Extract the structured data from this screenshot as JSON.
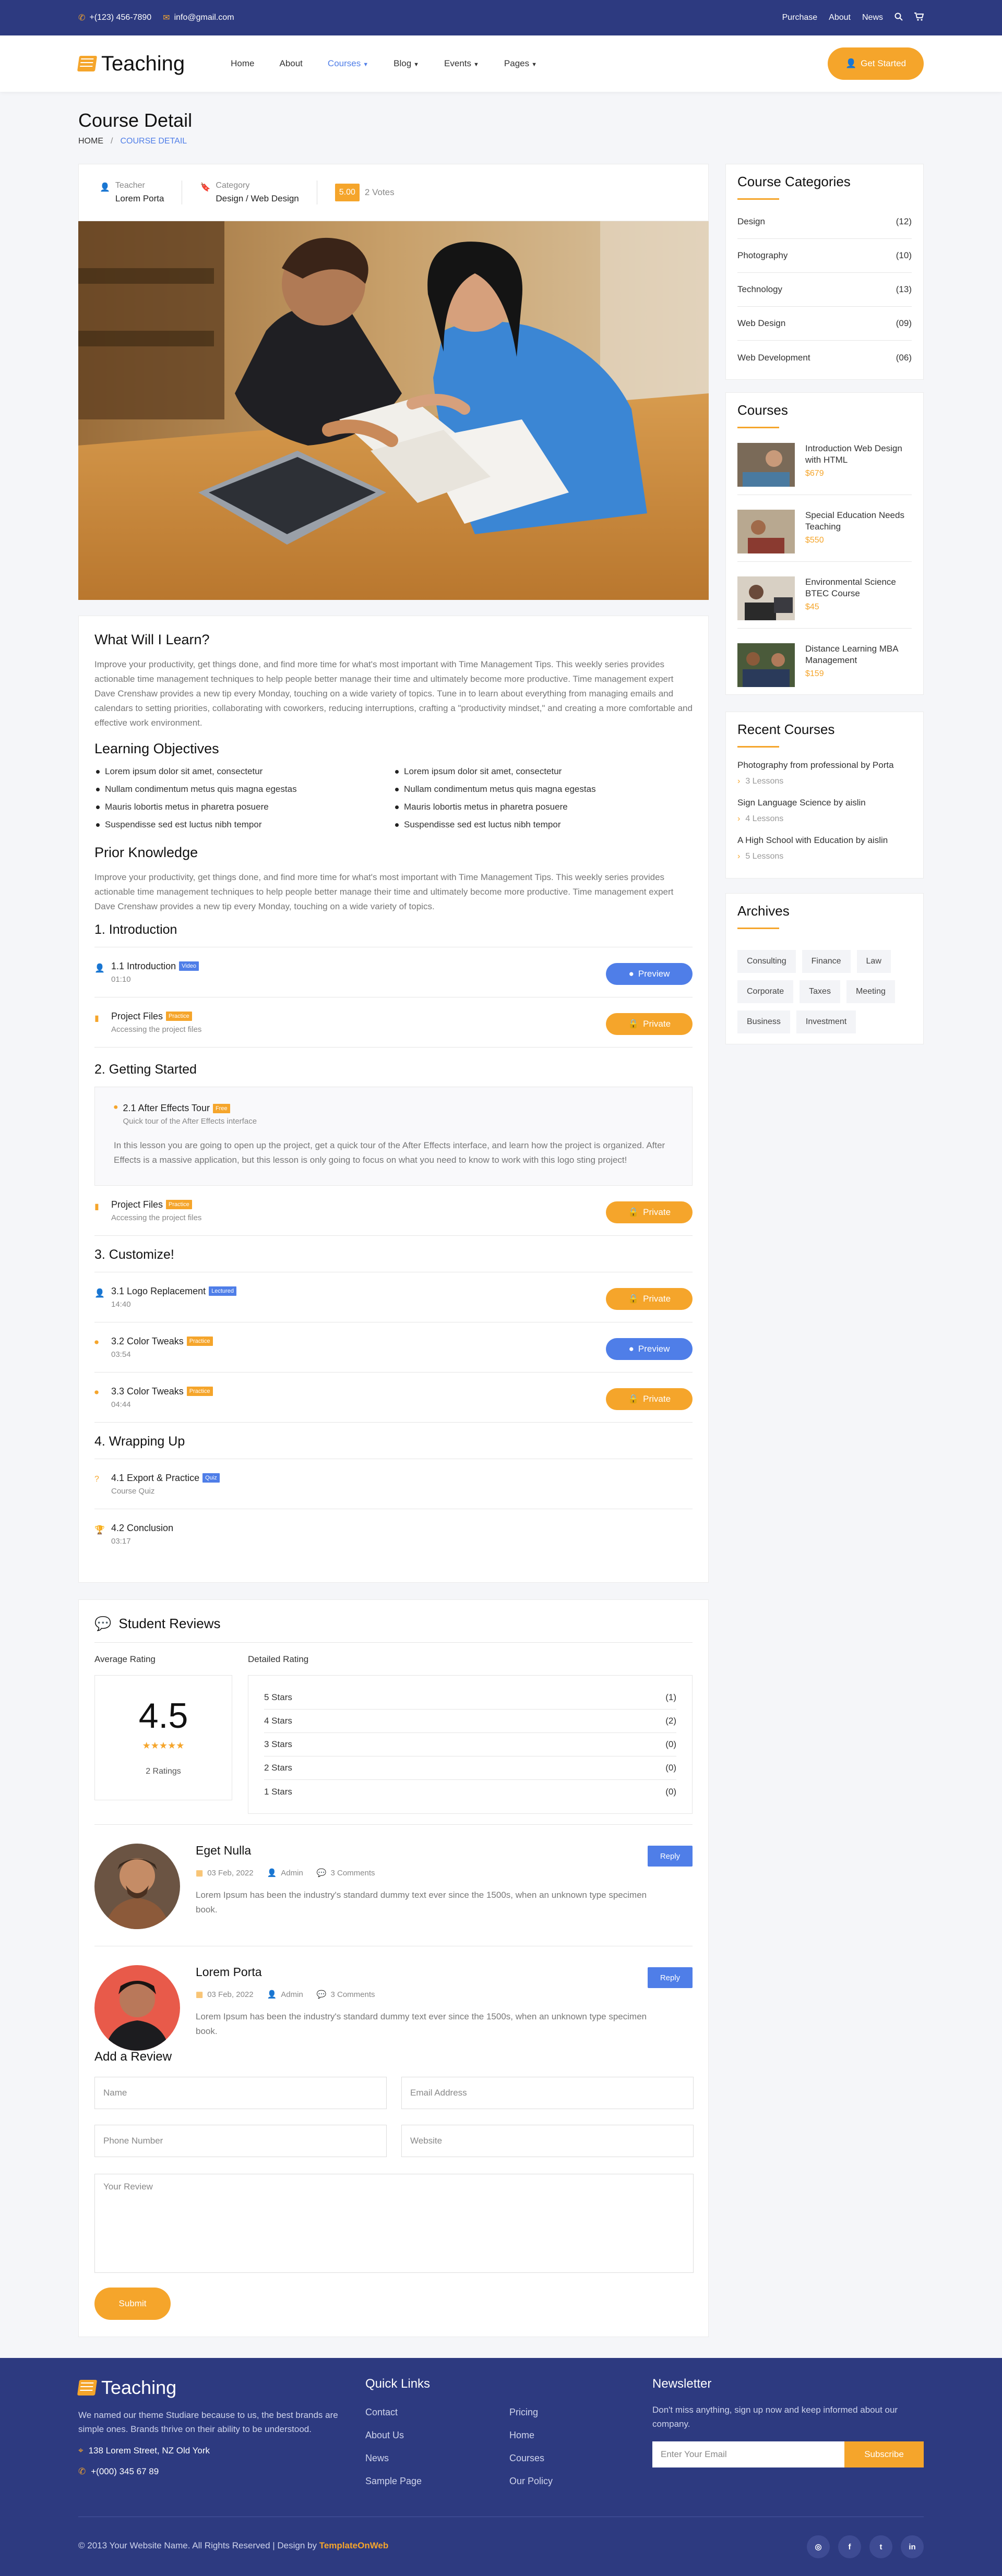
{
  "topbar": {
    "phone": "+(123) 456-7890",
    "email": "info@gmail.com",
    "links": [
      "Purchase",
      "About",
      "News"
    ]
  },
  "nav": {
    "logo": "Teaching",
    "items": [
      "Home",
      "About",
      "Courses",
      "Blog",
      "Events",
      "Pages"
    ],
    "cta": "Get Started"
  },
  "page": {
    "title": "Course Detail",
    "crumb_home": "HOME",
    "crumb_sep": "/",
    "crumb_current": "COURSE DETAIL"
  },
  "meta": {
    "teacher_label": "Teacher",
    "teacher": "Lorem Porta",
    "category_label": "Category",
    "category": "Design / Web Design",
    "rating": "5.00",
    "votes": "2 Votes"
  },
  "learn": {
    "title": "What Will I Learn?",
    "text": "Improve your productivity, get things done, and find more time for what's most important with Time Management Tips. This weekly series provides actionable time management techniques to help people better manage their time and ultimately become more productive. Time management expert Dave Crenshaw provides a new tip every Monday, touching on a wide variety of topics. Tune in to learn about everything from managing emails and calendars to setting priorities, collaborating with coworkers, reducing interruptions, crafting a \"productivity mindset,\" and creating a more comfortable and effective work environment.",
    "objectives_title": "Learning Objectives",
    "objectives": [
      "Lorem ipsum dolor sit amet, consectetur",
      "Lorem ipsum dolor sit amet, consectetur",
      "Nullam condimentum metus quis magna egestas",
      "Nullam condimentum metus quis magna egestas",
      "Mauris lobortis metus in pharetra posuere",
      "Mauris lobortis metus in pharetra posuere",
      "Suspendisse sed est luctus nibh tempor",
      "Suspendisse sed est luctus nibh tempor"
    ],
    "prior_title": "Prior Knowledge",
    "prior_text": "Improve your productivity, get things done, and find more time for what's most important with Time Management Tips. This weekly series provides actionable time management techniques to help people better manage their time and ultimately become more productive. Time management expert Dave Crenshaw provides a new tip every Monday, touching on a wide variety of topics."
  },
  "curriculum": {
    "s1": "1. Introduction",
    "l11": {
      "title": "1.1 Introduction",
      "tag": "Video",
      "sub": "01:10",
      "btn": "Preview"
    },
    "l12": {
      "title": "Project Files",
      "tag": "Practice",
      "sub": "Accessing the project files",
      "btn": "Private"
    },
    "s2": "2. Getting Started",
    "l21": {
      "title": "2.1 After Effects Tour",
      "tag": "Free",
      "sub": "Quick tour of the After Effects interface",
      "text": "In this lesson you are going to open up the project, get a quick tour of the After Effects interface, and learn how the project is organized. After Effects is a massive application, but this lesson is only going to focus on what you need to know to work with this logo sting project!"
    },
    "l22": {
      "title": "Project Files",
      "tag": "Practice",
      "sub": "Accessing the project files",
      "btn": "Private"
    },
    "s3": "3. Customize!",
    "l31": {
      "title": "3.1 Logo Replacement",
      "tag": "Lectured",
      "sub": "14:40",
      "btn": "Private"
    },
    "l32": {
      "title": "3.2 Color Tweaks",
      "tag": "Practice",
      "sub": "03:54",
      "btn": "Preview"
    },
    "l33": {
      "title": "3.3 Color Tweaks",
      "tag": "Practice",
      "sub": "04:44",
      "btn": "Private"
    },
    "s4": "4. Wrapping Up",
    "l41": {
      "title": "4.1 Export & Practice",
      "tag": "Quiz",
      "sub": "Course Quiz"
    },
    "l42": {
      "title": "4.2 Conclusion",
      "sub": "03:17"
    }
  },
  "reviews": {
    "title": "Student Reviews",
    "avg_label": "Average Rating",
    "det_label": "Detailed Rating",
    "avg": "4.5",
    "stars": "★★★★★",
    "count": "2 Ratings",
    "detail": [
      {
        "label": "5 Stars",
        "count": "(1)"
      },
      {
        "label": "4 Stars",
        "count": "(2)"
      },
      {
        "label": "3 Stars",
        "count": "(0)"
      },
      {
        "label": "2 Stars",
        "count": "(0)"
      },
      {
        "label": "1 Stars",
        "count": "(0)"
      }
    ],
    "items": [
      {
        "name": "Eget Nulla",
        "date": "03 Feb, 2022",
        "author": "Admin",
        "comments": "3 Comments",
        "text": "Lorem Ipsum has been the industry's standard dummy text ever since the 1500s, when an unknown type specimen book.",
        "reply": "Reply"
      },
      {
        "name": "Lorem Porta",
        "date": "03 Feb, 2022",
        "author": "Admin",
        "comments": "3 Comments",
        "text": "Lorem Ipsum has been the industry's standard dummy text ever since the 1500s, when an unknown type specimen book.",
        "reply": "Reply"
      }
    ],
    "form": {
      "title": "Add a Review",
      "name": "Name",
      "email": "Email Address",
      "phone": "Phone Number",
      "website": "Website",
      "review": "Your Review",
      "submit": "Submit"
    }
  },
  "sidebar": {
    "cat_title": "Course Categories",
    "cats": [
      {
        "name": "Design",
        "count": "(12)"
      },
      {
        "name": "Photography",
        "count": "(10)"
      },
      {
        "name": "Technology",
        "count": "(13)"
      },
      {
        "name": "Web Design",
        "count": "(09)"
      },
      {
        "name": "Web Development",
        "count": "(06)"
      }
    ],
    "courses_title": "Courses",
    "courses": [
      {
        "name": "Introduction Web Design with HTML",
        "price": "$679"
      },
      {
        "name": "Special Education Needs Teaching",
        "price": "$550"
      },
      {
        "name": "Environmental Science BTEC Course",
        "price": "$45"
      },
      {
        "name": "Distance Learning MBA Management",
        "price": "$159"
      }
    ],
    "recent_title": "Recent Courses",
    "recent": [
      {
        "name": "Photography from professional by Porta",
        "lessons": "3 Lessons"
      },
      {
        "name": "Sign Language Science by aislin",
        "lessons": "4 Lessons"
      },
      {
        "name": "A High School with Education by aislin",
        "lessons": "5 Lessons"
      }
    ],
    "archives_title": "Archives",
    "tags": [
      "Consulting",
      "Finance",
      "Law",
      "Corporate",
      "Taxes",
      "Meeting",
      "Business",
      "Investment"
    ]
  },
  "footer": {
    "logo": "Teaching",
    "about": "We named our theme Studiare because to us, the best brands are simple ones. Brands thrive on their ability to be understood.",
    "address": "138 Lorem Street, NZ Old York",
    "phone": "+(000) 345 67 89",
    "ql_title": "Quick Links",
    "links_a": [
      "Contact",
      "About Us",
      "News",
      "Sample Page"
    ],
    "links_b": [
      "Pricing",
      "Home",
      "Courses",
      "Our Policy"
    ],
    "news_title": "Newsletter",
    "news_text": "Don't miss anything, sign up now and keep informed about our company.",
    "news_placeholder": "Enter Your Email",
    "news_btn": "Subscribe",
    "copyright": "© 2013 Your Website Name. All Rights Reserved | Design by",
    "brand": "TemplateOnWeb",
    "socials": [
      "◎",
      "f",
      "t",
      "in"
    ]
  },
  "colors": {
    "accent": "#f5a52b",
    "primary": "#2d3a80",
    "link": "#4f7ee8"
  }
}
